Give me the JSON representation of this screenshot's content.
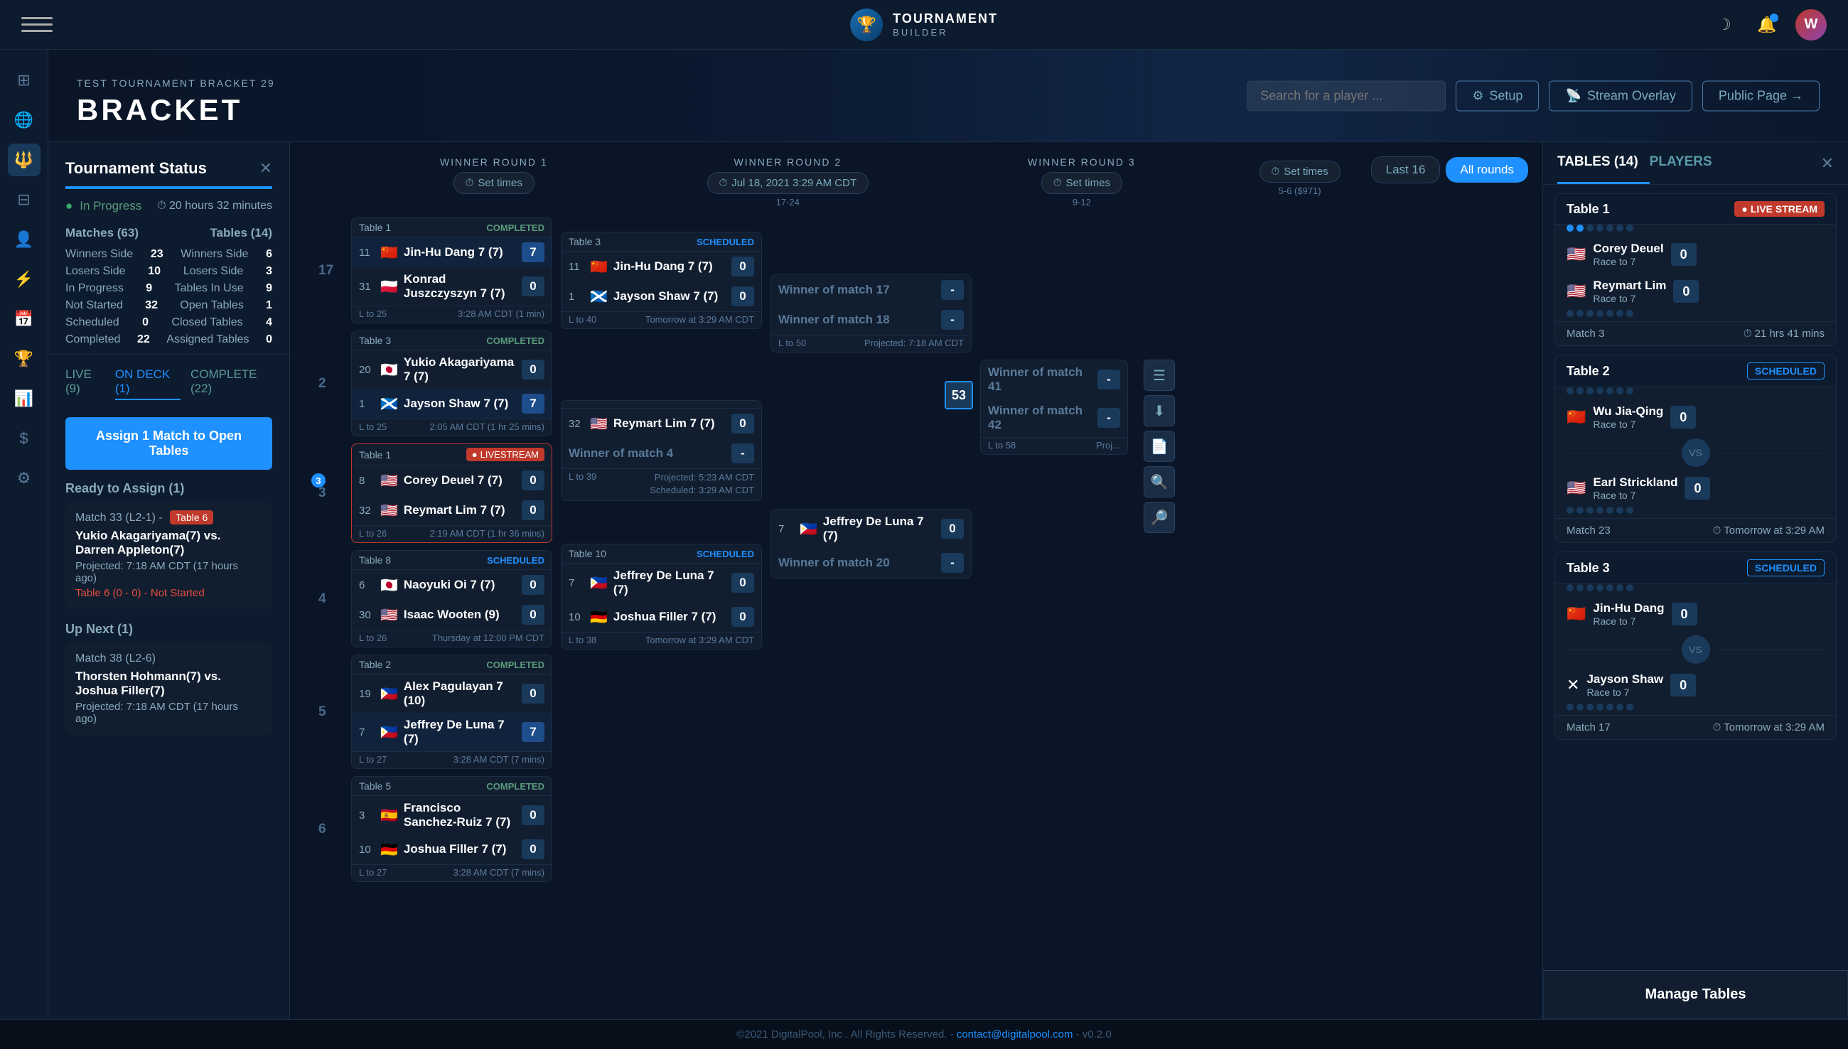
{
  "app": {
    "title": "TOURNAMENT BUILDER",
    "subtitle": "TOURNAMENT BUILDER"
  },
  "topnav": {
    "logo_icon": "🏆",
    "logo_line1": "TOURNAMENT",
    "logo_line2": "BUILDER",
    "avatar_initials": "W",
    "search_placeholder": "Search for a player ...",
    "btn_setup": "Setup",
    "btn_stream": "Stream Overlay",
    "btn_public": "Public Page →"
  },
  "hero": {
    "sub": "TEST TOURNAMENT BRACKET 29",
    "title": "BRACKET"
  },
  "left_panel": {
    "title": "Tournament Status",
    "status_in_progress": "In Progress",
    "status_time": "20 hours 32 minutes",
    "stats": [
      {
        "label": "Matches (63)",
        "value": "",
        "sub": true
      },
      {
        "label": "Tables (14)",
        "value": "",
        "sub": true
      },
      {
        "label": "Winners Side",
        "left_val": "23",
        "right_label": "Winners Side",
        "right_val": "6"
      },
      {
        "label": "Losers Side",
        "left_val": "10",
        "right_label": "Losers Side",
        "right_val": "3"
      },
      {
        "label": "In Progress",
        "left_val": "9",
        "right_label": "Tables In Use",
        "right_val": "9"
      },
      {
        "label": "Not Started",
        "left_val": "32",
        "right_label": "Open Tables",
        "right_val": "1"
      },
      {
        "label": "Scheduled",
        "left_val": "0",
        "right_label": "Closed Tables",
        "right_val": "4"
      },
      {
        "label": "Completed",
        "left_val": "22",
        "right_label": "Assigned Tables",
        "right_val": "0"
      }
    ],
    "tabs": [
      "LIVE (9)",
      "ON DECK (1)",
      "COMPLETE (22)"
    ],
    "active_tab": 1,
    "assign_btn": "Assign 1 Match to Open Tables",
    "ready_section": "Ready to Assign (1)",
    "match_33": {
      "label": "Match 33 (L2-1) -",
      "table_badge": "Table 6",
      "players": "Yukio Akagariyama(7) vs. Darren Appleton(7)",
      "projected": "Projected: 7:18 AM CDT (17 hours ago)",
      "status": "Table 6 (0 - 0) - Not Started"
    },
    "up_next_section": "Up Next (1)",
    "match_38": {
      "label": "Match 38 (L2-6)",
      "players": "Thorsten Hohmann(7) vs. Joshua Filler(7)",
      "projected": "Projected: 7:18 AM CDT (17 hours ago)"
    }
  },
  "bracket": {
    "rounds": [
      {
        "label": "WINNER ROUND 1",
        "date_btn": "⏱ Set times",
        "range": ""
      },
      {
        "label": "WINNER ROUND 2",
        "date_btn": "⏱ Jul 18, 2021 3:29 AM CDT",
        "range": "17-24"
      },
      {
        "label": "WINNER ROUND 3",
        "date_btn": "⏱ Set times",
        "range": "9-12"
      },
      {
        "label": "",
        "date_btn": "⏱ Set times",
        "range": "5-6 ($971)"
      }
    ],
    "filter_last16": "Last 16",
    "filter_allrounds": "All rounds",
    "col1_matches": [
      {
        "table": "Table 1",
        "status": "COMPLETED",
        "num": "11",
        "p1_num": "11",
        "p1_flag": "🇨🇳",
        "p1_name": "Jin-Hu Dang 7 (7)",
        "p1_score": "7",
        "p1_winner": true,
        "p2_num": "31",
        "p2_flag": "🇵🇱",
        "p2_name": "Konrad Juszczyszyn 7 (7)",
        "p2_score": "0",
        "footer": "L to 25   3:28 AM CDT (1 min)",
        "match_idx": "17"
      },
      {
        "table": "Table 3",
        "status": "COMPLETED",
        "p1_num": "20",
        "p1_flag": "🇯🇵",
        "p1_name": "Yukio Akagariyama 7 (7)",
        "p1_score": "0",
        "p2_num": "1",
        "p2_flag": "🏴󠁧󠁢󠁳󠁣󠁴󠁿",
        "p2_name": "Jayson Shaw 7 (7)",
        "p2_score": "7",
        "p2_winner": true,
        "footer": "L to 25   2:05 AM CDT (1 hr 25 mins)",
        "match_idx": "2"
      },
      {
        "table": "Table 1",
        "status": "LIVESTREAM",
        "p1_num": "8",
        "p1_flag": "🇺🇸",
        "p1_name": "Corey Deuel 7 (7)",
        "p1_score": "0",
        "p2_num": "32",
        "p2_flag": "🇺🇸",
        "p2_name": "Reymart Lim 7 (7)",
        "p2_score": "0",
        "footer": "L to 26   2:19 AM CDT (1 hr 36 mins)",
        "match_idx": "3"
      },
      {
        "table": "Table 8",
        "status": "SCHEDULED",
        "p1_num": "6",
        "p1_flag": "🇯🇵",
        "p1_name": "Naoyuki Oi 7 (7)",
        "p1_score": "0",
        "p2_num": "30",
        "p2_flag": "🇺🇸",
        "p2_name": "Isaac Wooten (9)",
        "p2_score": "0",
        "footer": "L to 26   Thursday at 12:00 PM CDT",
        "match_idx": "4"
      },
      {
        "table": "Table 2",
        "status": "COMPLETED",
        "p1_num": "19",
        "p1_flag": "🇵🇭",
        "p1_name": "Alex Pagulayan 7 (10)",
        "p1_score": "0",
        "p2_num": "7",
        "p2_flag": "🇵🇭",
        "p2_name": "Jeffrey De Luna 7 (7)",
        "p2_score": "7",
        "p2_winner": true,
        "footer": "L to 27   3:28 AM CDT (7 mins)",
        "match_idx": "5"
      },
      {
        "table": "Table 5",
        "status": "COMPLETED",
        "p1_num": "3",
        "p1_flag": "🇪🇸",
        "p1_name": "Francisco Sanchez-Ruiz 7 (7)",
        "p1_score": "0",
        "p2_num": "10",
        "p2_flag": "🇩🇪",
        "p2_name": "Joshua Filler 7 (7)",
        "p2_score": "0",
        "footer": "L to 27   3:28 AM CDT (7 mins)",
        "match_idx": "6"
      }
    ],
    "col2_matches": [
      {
        "table": "Table 3",
        "status": "SCHEDULED",
        "p1_num": "11",
        "p1_flag": "🇨🇳",
        "p1_name": "Jin-Hu Dang 7 (7)",
        "p1_score": "0",
        "p2_num": "1",
        "p2_flag": "🏴󠁧󠁢󠁳󠁣󠁴󠁿",
        "p2_name": "Jayson Shaw 7 (7)",
        "p2_score": "0",
        "footer_left": "L to 40",
        "footer_right": "Tomorrow at 3:29 AM CDT",
        "match_idx": "17"
      },
      {
        "p1_name": "32 🇺🇸 Reymart Lim 7 (7)",
        "p1_score": "0",
        "p2_name": "Winner of match 4",
        "p2_score": "-",
        "footer_left": "L to 39",
        "footer_right": "Projected: 5:23 AM CDT\nScheduled: 3:29 AM CDT",
        "match_idx": "18",
        "special": true,
        "p1_num": "32",
        "p1_flag": "🇺🇸",
        "p1_real": "Reymart Lim 7 (7)"
      },
      {
        "table": "Table 10",
        "status": "SCHEDULED",
        "p1_num": "7",
        "p1_flag": "🇵🇭",
        "p1_name": "Jeffrey De Luna 7 (7)",
        "p1_score": "0",
        "p2_num": "10",
        "p2_flag": "🇩🇪",
        "p2_name": "Joshua Filler 7 (7)",
        "p2_score": "0",
        "footer_left": "L to 38",
        "footer_right": "Tomorrow at 3:29 AM CDT",
        "match_idx": "19"
      }
    ],
    "col3_matches": [
      {
        "p1_name": "Winner of match 17",
        "p2_name": "Winner of match 18",
        "footer_left": "L to 50",
        "footer_right": "Projected: 7:18 AM CDT",
        "match_idx": "41"
      },
      {
        "p1_name": "7 🇵🇭 Jeffrey De Luna 7 (7)",
        "p2_name": "Winner of match 20",
        "footer_left": "",
        "footer_right": "",
        "match_idx": "42",
        "special_p1": true
      }
    ],
    "col4_matches": [
      {
        "match_num": 53,
        "p1_name": "Winner of match 41",
        "p2_name": "Winner of match 42",
        "footer_left": "L to 58",
        "footer_right": "Proj..."
      }
    ]
  },
  "right_panel": {
    "tabs": [
      "TABLES (14)",
      "PLAYERS"
    ],
    "active_tab": 0,
    "tables": [
      {
        "name": "Table 1",
        "status": "LIVE STREAM",
        "status_type": "live",
        "p1_flag": "🇺🇸",
        "p1_name": "Corey Deuel",
        "p1_sub": "Race to 7",
        "p1_score": "0",
        "p2_flag": "🇺🇸",
        "p2_name": "Reymart Lim",
        "p2_sub": "Race to 7",
        "p2_score": "0",
        "match_label": "Match 3",
        "time_label": "21 hrs 41 mins"
      },
      {
        "name": "Table 2",
        "status": "SCHEDULED",
        "status_type": "scheduled",
        "p1_flag": "🇨🇳",
        "p1_name": "Wu Jia-Qing",
        "p1_sub": "Race to 7",
        "p1_score": "0",
        "p2_flag": "🇺🇸",
        "p2_name": "Earl Strickland",
        "p2_sub": "Race to 7",
        "p2_score": "0",
        "match_label": "Match 23",
        "time_label": "Tomorrow at 3:29 AM"
      },
      {
        "name": "Table 3",
        "status": "SCHEDULED",
        "status_type": "scheduled",
        "p1_flag": "🇨🇳",
        "p1_name": "Jin-Hu Dang",
        "p1_sub": "Race to 7",
        "p1_score": "0",
        "p2_flag": "✕",
        "p2_name": "Jayson Shaw",
        "p2_sub": "Race to 7",
        "p2_score": "0",
        "match_label": "Match 17",
        "time_label": "Tomorrow at 3:29 AM"
      }
    ],
    "manage_tables_btn": "Manage Tables"
  },
  "footer": {
    "text": "©2021 DigitalPool, Inc . All Rights Reserved. -",
    "link_text": "contact@digitalpool.com",
    "version": "- v0.2.0"
  }
}
